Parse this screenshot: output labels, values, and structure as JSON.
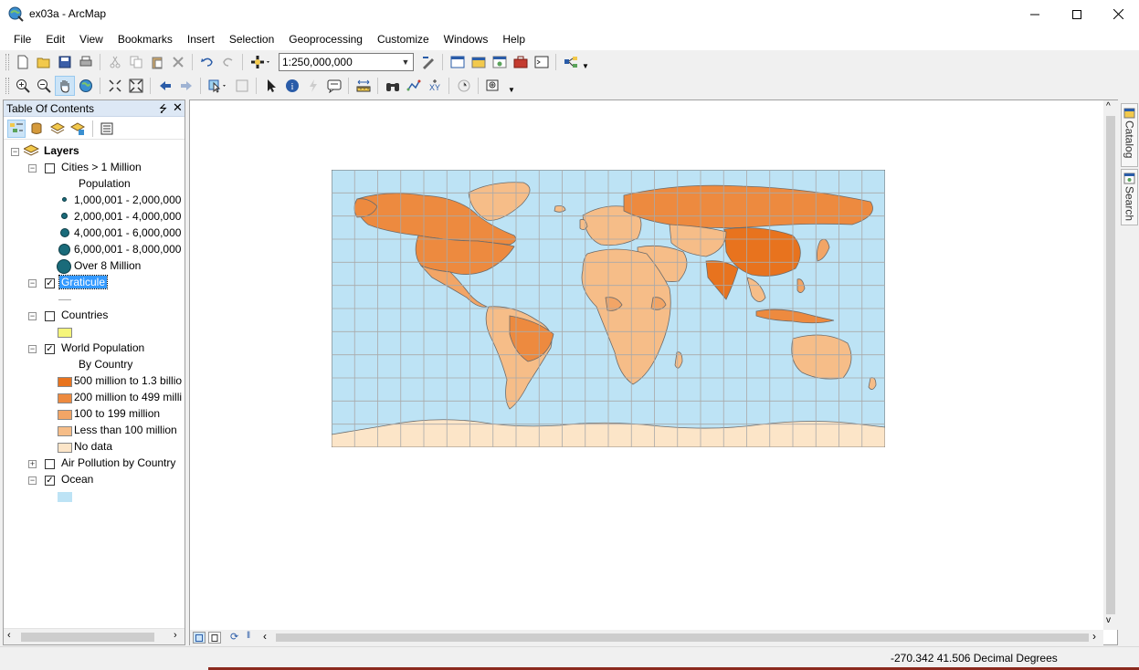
{
  "window": {
    "title": "ex03a - ArcMap",
    "minimize_icon": "minimize-icon",
    "maximize_icon": "maximize-icon",
    "close_icon": "close-icon"
  },
  "menu": [
    "File",
    "Edit",
    "View",
    "Bookmarks",
    "Insert",
    "Selection",
    "Geoprocessing",
    "Customize",
    "Windows",
    "Help"
  ],
  "standard_toolbar": {
    "scale_value": "1:250,000,000"
  },
  "toc": {
    "title": "Table Of Contents",
    "pin_glyph": "⭍",
    "close_glyph": "✕",
    "root_label": "Layers",
    "layers": {
      "cities": {
        "name": "Cities > 1 Million",
        "checked": false,
        "field": "Population",
        "classes": [
          "1,000,001 - 2,000,000",
          "2,000,001 - 4,000,000",
          "4,000,001 - 6,000,000",
          "6,000,001 - 8,000,000",
          "Over 8 Million"
        ]
      },
      "graticule": {
        "name": "Graticule",
        "checked": true
      },
      "countries": {
        "name": "Countries",
        "checked": false,
        "color": "#f5f57a"
      },
      "world_population": {
        "name": "World Population",
        "checked": true,
        "field": "By Country",
        "classes": [
          {
            "label": "500 million to 1.3 billio",
            "color": "#e8731e"
          },
          {
            "label": "200 million to 499 milli",
            "color": "#ed8a3f"
          },
          {
            "label": "100 to 199 million",
            "color": "#f2a566"
          },
          {
            "label": "Less than 100 million",
            "color": "#f6bd88"
          },
          {
            "label": "No data",
            "color": "#fce5c8"
          }
        ]
      },
      "air_pollution": {
        "name": "Air Pollution by Country",
        "checked": false
      },
      "ocean": {
        "name": "Ocean",
        "checked": true,
        "color": "#bde3f5"
      }
    }
  },
  "dock": {
    "catalog_label": "Catalog",
    "search_label": "Search"
  },
  "status": {
    "coordinates": "-270.342  41.506 Decimal Degrees"
  },
  "colors": {
    "ocean": "#bde3f5",
    "graticule": "#a9a9a9",
    "land_outline": "#6b6b6b",
    "selection": "#3399ff"
  }
}
